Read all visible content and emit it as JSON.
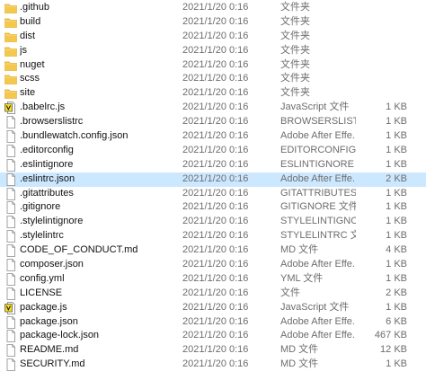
{
  "colors": {
    "folder": "#f4c84d",
    "folder_dark": "#dca629",
    "selection": "#cce8ff",
    "js_badge": "#f7df1e"
  },
  "files": [
    {
      "name": ".github",
      "date": "2021/1/20 0:16",
      "type": "文件夹",
      "size": "",
      "icon": "folder-icon"
    },
    {
      "name": "build",
      "date": "2021/1/20 0:16",
      "type": "文件夹",
      "size": "",
      "icon": "folder-icon"
    },
    {
      "name": "dist",
      "date": "2021/1/20 0:16",
      "type": "文件夹",
      "size": "",
      "icon": "folder-icon"
    },
    {
      "name": "js",
      "date": "2021/1/20 0:16",
      "type": "文件夹",
      "size": "",
      "icon": "folder-icon"
    },
    {
      "name": "nuget",
      "date": "2021/1/20 0:16",
      "type": "文件夹",
      "size": "",
      "icon": "folder-icon"
    },
    {
      "name": "scss",
      "date": "2021/1/20 0:16",
      "type": "文件夹",
      "size": "",
      "icon": "folder-icon"
    },
    {
      "name": "site",
      "date": "2021/1/20 0:16",
      "type": "文件夹",
      "size": "",
      "icon": "folder-icon"
    },
    {
      "name": ".babelrc.js",
      "date": "2021/1/20 0:16",
      "type": "JavaScript 文件",
      "size": "1 KB",
      "icon": "js-file-icon"
    },
    {
      "name": ".browserslistrc",
      "date": "2021/1/20 0:16",
      "type": "BROWSERSLIST...",
      "size": "1 KB",
      "icon": "file-icon"
    },
    {
      "name": ".bundlewatch.config.json",
      "date": "2021/1/20 0:16",
      "type": "Adobe After Effe...",
      "size": "1 KB",
      "icon": "file-icon"
    },
    {
      "name": ".editorconfig",
      "date": "2021/1/20 0:16",
      "type": "EDITORCONFIG ...",
      "size": "1 KB",
      "icon": "file-icon"
    },
    {
      "name": ".eslintignore",
      "date": "2021/1/20 0:16",
      "type": "ESLINTIGNORE ...",
      "size": "1 KB",
      "icon": "file-icon"
    },
    {
      "name": ".eslintrc.json",
      "date": "2021/1/20 0:16",
      "type": "Adobe After Effe...",
      "size": "2 KB",
      "icon": "file-icon",
      "selected": true
    },
    {
      "name": ".gitattributes",
      "date": "2021/1/20 0:16",
      "type": "GITATTRIBUTES ...",
      "size": "1 KB",
      "icon": "file-icon"
    },
    {
      "name": ".gitignore",
      "date": "2021/1/20 0:16",
      "type": "GITIGNORE 文件",
      "size": "1 KB",
      "icon": "file-icon"
    },
    {
      "name": ".stylelintignore",
      "date": "2021/1/20 0:16",
      "type": "STYLELINTIGNO...",
      "size": "1 KB",
      "icon": "file-icon"
    },
    {
      "name": ".stylelintrc",
      "date": "2021/1/20 0:16",
      "type": "STYLELINTRC 文件",
      "size": "1 KB",
      "icon": "file-icon"
    },
    {
      "name": "CODE_OF_CONDUCT.md",
      "date": "2021/1/20 0:16",
      "type": "MD 文件",
      "size": "4 KB",
      "icon": "file-icon"
    },
    {
      "name": "composer.json",
      "date": "2021/1/20 0:16",
      "type": "Adobe After Effe...",
      "size": "1 KB",
      "icon": "file-icon"
    },
    {
      "name": "config.yml",
      "date": "2021/1/20 0:16",
      "type": "YML 文件",
      "size": "1 KB",
      "icon": "file-icon"
    },
    {
      "name": "LICENSE",
      "date": "2021/1/20 0:16",
      "type": "文件",
      "size": "2 KB",
      "icon": "file-icon"
    },
    {
      "name": "package.js",
      "date": "2021/1/20 0:16",
      "type": "JavaScript 文件",
      "size": "1 KB",
      "icon": "js-file-icon"
    },
    {
      "name": "package.json",
      "date": "2021/1/20 0:16",
      "type": "Adobe After Effe...",
      "size": "6 KB",
      "icon": "file-icon"
    },
    {
      "name": "package-lock.json",
      "date": "2021/1/20 0:16",
      "type": "Adobe After Effe...",
      "size": "467 KB",
      "icon": "file-icon"
    },
    {
      "name": "README.md",
      "date": "2021/1/20 0:16",
      "type": "MD 文件",
      "size": "12 KB",
      "icon": "file-icon"
    },
    {
      "name": "SECURITY.md",
      "date": "2021/1/20 0:16",
      "type": "MD 文件",
      "size": "1 KB",
      "icon": "file-icon"
    }
  ]
}
